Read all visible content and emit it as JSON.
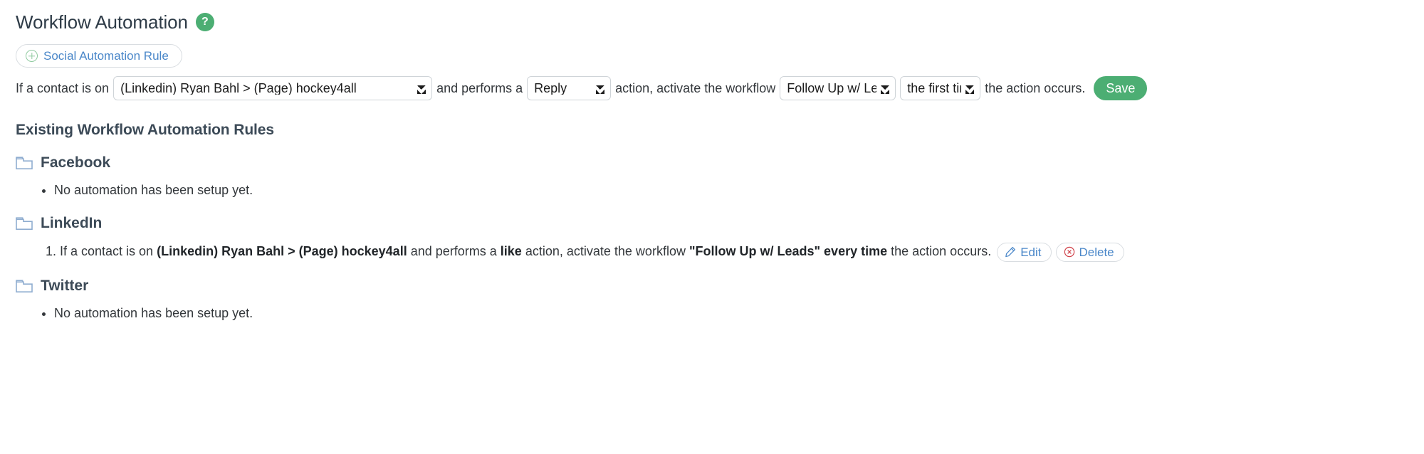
{
  "header": {
    "title": "Workflow Automation",
    "help_icon_label": "?",
    "help_icon_name": "question-mark-icon"
  },
  "add_rule_button": {
    "label": "Social Automation Rule",
    "icon": "plus-circle-icon"
  },
  "builder": {
    "text_1": "If a contact is on",
    "account_select": {
      "value": "(Linkedin) Ryan Bahl > (Page) hockey4all",
      "options": [
        "(Linkedin) Ryan Bahl > (Page) hockey4all"
      ]
    },
    "text_2": "and performs a",
    "action_select": {
      "value": "Reply",
      "options": [
        "Reply"
      ]
    },
    "text_3": "action, activate the workflow",
    "workflow_select": {
      "value": "Follow Up w/ Leads",
      "options": [
        "Follow Up w/ Leads"
      ]
    },
    "frequency_select": {
      "value": "the first time",
      "options": [
        "the first time"
      ]
    },
    "text_4": "the action occurs.",
    "save_label": "Save"
  },
  "existing": {
    "heading": "Existing Workflow Automation Rules",
    "groups": [
      {
        "name": "Facebook",
        "icon": "folder-icon",
        "empty_message": "No automation has been setup yet.",
        "rules": []
      },
      {
        "name": "LinkedIn",
        "icon": "folder-icon",
        "empty_message": "",
        "rules": [
          {
            "number": "1.",
            "prefix": "If a contact is on",
            "account": "(Linkedin) Ryan Bahl > (Page) hockey4all",
            "mid_1": "and performs a",
            "action": "like",
            "mid_2": "action, activate the workflow",
            "workflow": "\"Follow Up w/ Leads\" every time",
            "suffix": "the action occurs.",
            "edit_label": "Edit",
            "delete_label": "Delete"
          }
        ]
      },
      {
        "name": "Twitter",
        "icon": "folder-icon",
        "empty_message": "No automation has been setup yet.",
        "rules": []
      }
    ]
  },
  "colors": {
    "accent_green": "#4cae73",
    "link_blue": "#4a87c9",
    "heading_slate": "#3c4a57",
    "folder_blue": "#8fadd0",
    "danger_red": "#d0434a"
  }
}
